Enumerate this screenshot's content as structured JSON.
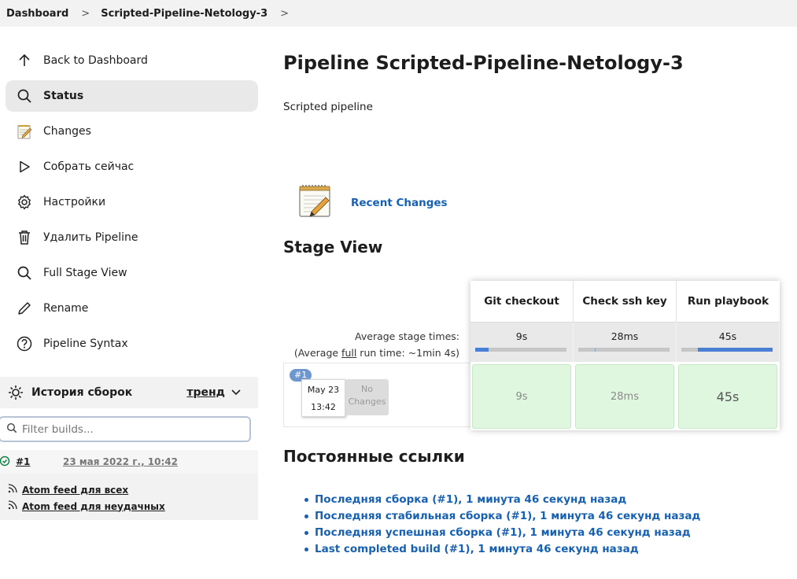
{
  "breadcrumb": {
    "items": [
      "Dashboard",
      "Scripted-Pipeline-Netology-3"
    ]
  },
  "sidebar": {
    "items": [
      {
        "label": "Back to Dashboard",
        "icon": "arrow-up-icon"
      },
      {
        "label": "Status",
        "icon": "search-icon",
        "active": true
      },
      {
        "label": "Changes",
        "icon": "notepad-icon"
      },
      {
        "label": "Собрать сейчас",
        "icon": "play-icon"
      },
      {
        "label": "Настройки",
        "icon": "gear-icon"
      },
      {
        "label": "Удалить Pipeline",
        "icon": "trash-icon"
      },
      {
        "label": "Full Stage View",
        "icon": "search-icon"
      },
      {
        "label": "Rename",
        "icon": "pencil-icon"
      },
      {
        "label": "Pipeline Syntax",
        "icon": "help-icon"
      }
    ]
  },
  "history": {
    "title": "История сборок",
    "trend": "тренд",
    "filter_placeholder": "Filter builds...",
    "builds": [
      {
        "number": "#1",
        "date": "23 мая 2022 г., 10:42",
        "status": "success"
      }
    ],
    "feeds": [
      "Atom feed для всех",
      "Atom feed для неудачных"
    ]
  },
  "main": {
    "title": "Pipeline Scripted-Pipeline-Netology-3",
    "description": "Scripted pipeline",
    "recent_changes": "Recent Changes",
    "stage_view_title": "Stage View",
    "avg_stage_times": "Average stage times:",
    "avg_run_prefix": "(Average ",
    "avg_run_full": "full",
    "avg_run_suffix": " run time: ~1min 4s)",
    "run": {
      "badge": "#1",
      "date": "May 23",
      "time": "13:42",
      "no_changes_1": "No",
      "no_changes_2": "Changes"
    },
    "stages": [
      {
        "name": "Git checkout",
        "avg": "9s",
        "cell": "9s",
        "avg_fraction": 0.15
      },
      {
        "name": "Check ssh key",
        "avg": "28ms",
        "cell": "28ms",
        "avg_fraction": 0.01
      },
      {
        "name": "Run playbook",
        "avg": "45s",
        "cell": "45s",
        "avg_fraction": 0.82
      }
    ],
    "permalinks_title": "Постоянные ссылки",
    "permalinks": [
      "Последняя сборка (#1), 1 минута 46 секунд назад",
      "Последняя стабильная сборка (#1), 1 минута 46 секунд назад",
      "Последняя успешная сборка (#1), 1 минута 46 секунд назад",
      "Last completed build (#1), 1 минута 46 секунд назад"
    ]
  }
}
